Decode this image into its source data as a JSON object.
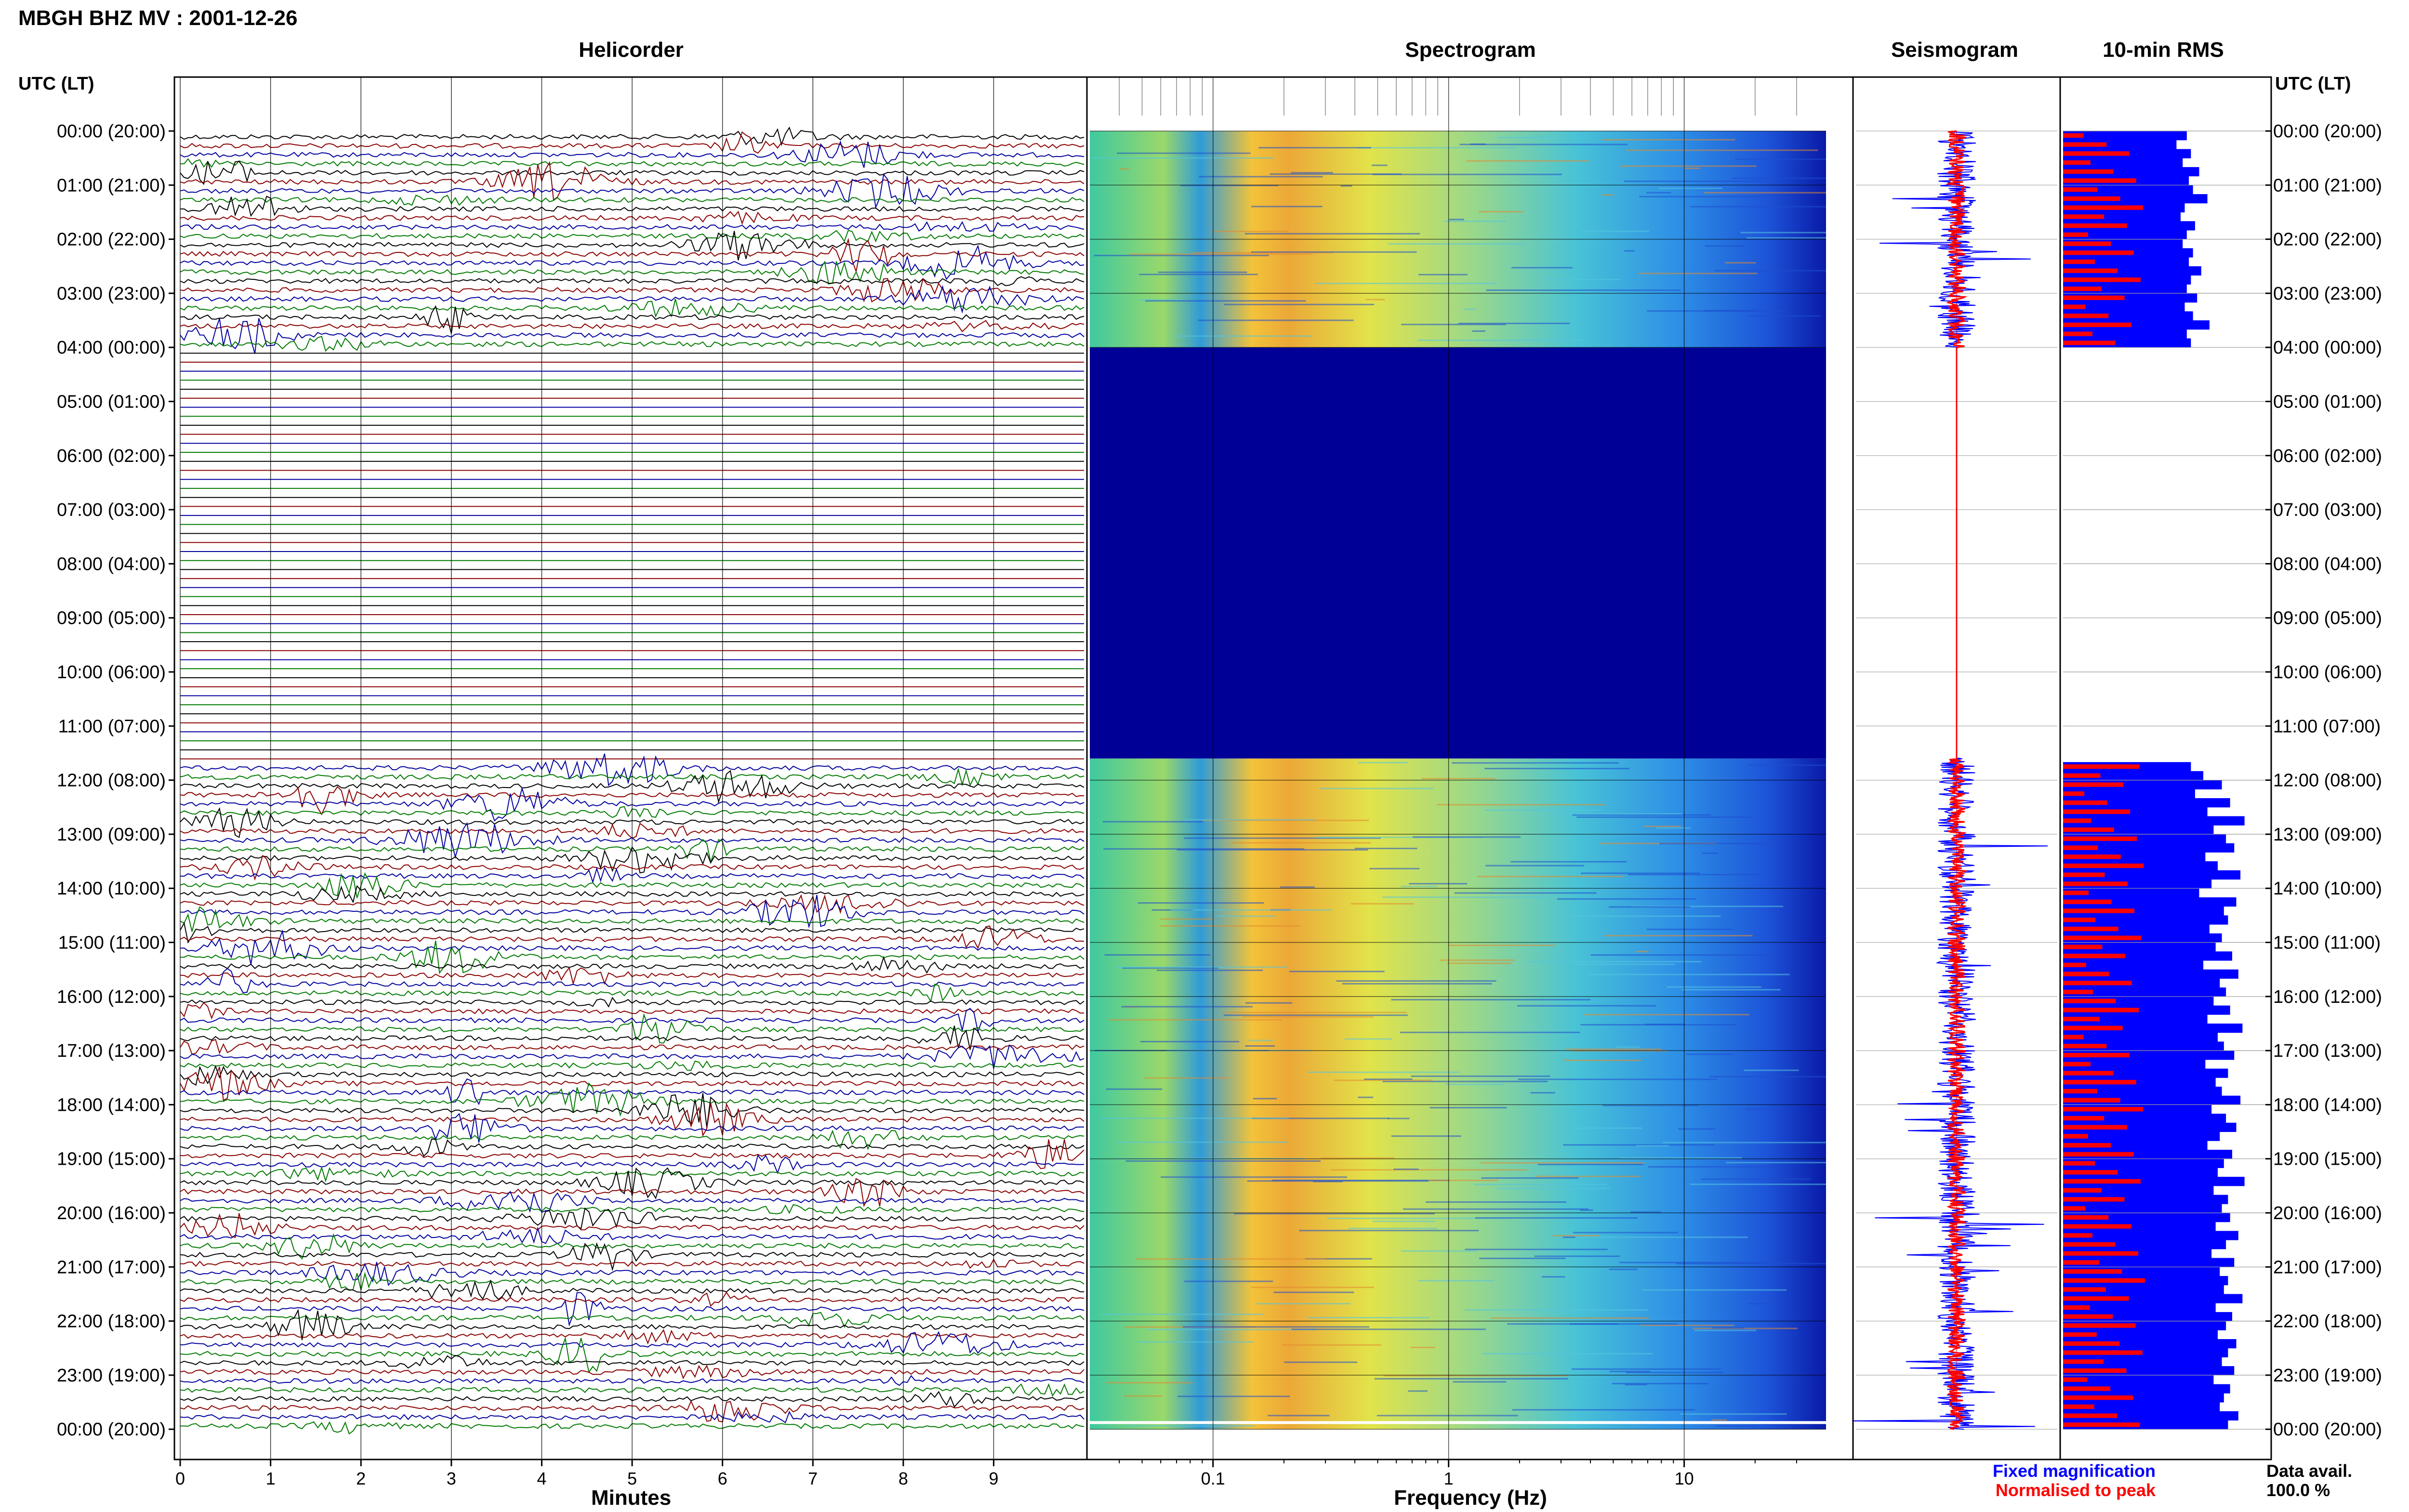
{
  "page_title": "MBGH BHZ MV : 2001-12-26",
  "left_axis_header": "UTC (LT)",
  "right_axis_header": "UTC (LT)",
  "panels": {
    "helicorder": {
      "title": "Helicorder",
      "xlabel": "Minutes"
    },
    "spectrogram": {
      "title": "Spectrogram",
      "xlabel": "Frequency (Hz)"
    },
    "seismogram": {
      "title": "Seismogram"
    },
    "rms": {
      "title": "10-min RMS"
    }
  },
  "legend": {
    "fixed": {
      "label": "Fixed magnification",
      "color": "#0000ff"
    },
    "normalised": {
      "label": "Normalised to peak",
      "color": "#ff0000"
    }
  },
  "data_avail": {
    "label": "Data avail.",
    "value": "100.0 %"
  },
  "colors": {
    "trace_cycle": [
      "#000000",
      "#8b0000",
      "#0000a0",
      "#007a00"
    ],
    "no_data": "#000096"
  },
  "chart_data": {
    "type": "helicorder",
    "y_tick_labels": [
      "00:00 (20:00)",
      "01:00 (21:00)",
      "02:00 (22:00)",
      "03:00 (23:00)",
      "04:00 (00:00)",
      "05:00 (01:00)",
      "06:00 (02:00)",
      "07:00 (03:00)",
      "08:00 (04:00)",
      "09:00 (05:00)",
      "10:00 (06:00)",
      "11:00 (07:00)",
      "12:00 (08:00)",
      "13:00 (09:00)",
      "14:00 (10:00)",
      "15:00 (11:00)",
      "16:00 (12:00)",
      "17:00 (13:00)",
      "18:00 (14:00)",
      "19:00 (15:00)",
      "20:00 (16:00)",
      "21:00 (17:00)",
      "22:00 (18:00)",
      "23:00 (19:00)",
      "00:00 (20:00)"
    ],
    "helicorder_x": {
      "label": "Minutes",
      "range": [
        0,
        10
      ],
      "ticks": [
        0,
        1,
        2,
        3,
        4,
        5,
        6,
        7,
        8,
        9
      ]
    },
    "spectrogram_x": {
      "label": "Frequency (Hz)",
      "scale": "log",
      "range": [
        0.03,
        40
      ],
      "ticks": [
        0.1,
        1,
        10
      ],
      "tick_labels": [
        "0.1",
        "1",
        "10"
      ]
    },
    "data_gap_utc": [
      4.0,
      11.6
    ],
    "rms_per_10min": [
      0.6,
      0.55,
      0.62,
      0.58,
      0.66,
      0.61,
      0.63,
      0.7,
      0.59,
      0.57,
      0.64,
      0.6,
      0.58,
      0.63,
      0.61,
      0.67,
      0.62,
      0.6,
      0.65,
      0.59,
      0.63,
      0.71,
      0.6,
      0.62,
      null,
      null,
      null,
      null,
      null,
      null,
      null,
      null,
      null,
      null,
      null,
      null,
      null,
      null,
      null,
      null,
      null,
      null,
      null,
      null,
      null,
      null,
      null,
      null,
      null,
      null,
      null,
      null,
      null,
      null,
      null,
      null,
      null,
      null,
      null,
      null,
      null,
      null,
      null,
      null,
      null,
      null,
      null,
      null,
      null,
      null,
      0.62,
      0.68,
      0.77,
      0.64,
      0.81,
      0.7,
      0.88,
      0.73,
      0.79,
      0.83,
      0.69,
      0.75,
      0.86,
      0.72,
      0.66,
      0.84,
      0.78,
      0.8,
      0.71,
      0.77,
      0.74,
      0.82,
      0.68,
      0.85,
      0.76,
      0.79,
      0.73,
      0.81,
      0.7,
      0.87,
      0.75,
      0.78,
      0.83,
      0.69,
      0.8,
      0.74,
      0.77,
      0.86,
      0.72,
      0.79,
      0.84,
      0.76,
      0.7,
      0.82,
      0.78,
      0.75,
      0.88,
      0.73,
      0.8,
      0.77,
      0.81,
      0.74,
      0.85,
      0.79,
      0.72,
      0.83,
      0.76,
      0.8,
      0.78,
      0.87,
      0.74,
      0.82,
      0.79,
      0.75,
      0.84,
      0.8,
      0.77,
      0.83,
      0.73,
      0.81,
      0.78,
      0.76,
      0.85,
      0.8
    ]
  }
}
